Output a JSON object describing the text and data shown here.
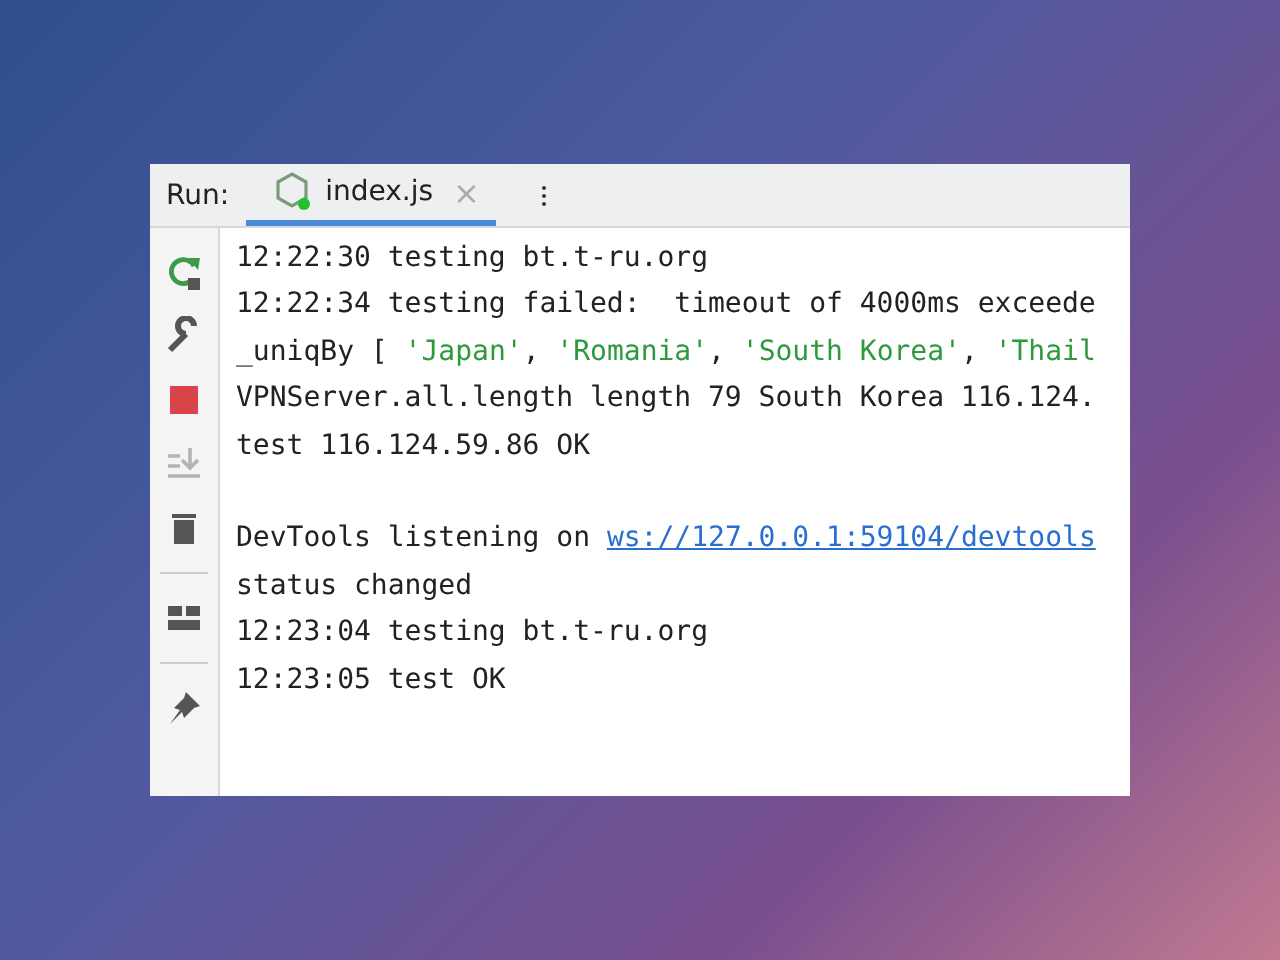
{
  "panel": {
    "label": "Run:",
    "tabs": [
      {
        "label": "index.js",
        "close": "×",
        "selected": true
      }
    ]
  },
  "toolbar": [
    {
      "kind": "rerun",
      "disabled": false
    },
    {
      "kind": "wrench",
      "disabled": false
    },
    {
      "kind": "stop",
      "disabled": false
    },
    {
      "kind": "scroll-end",
      "disabled": true
    },
    {
      "kind": "trash",
      "disabled": false
    },
    {
      "kind": "divider"
    },
    {
      "kind": "layout",
      "disabled": false
    },
    {
      "kind": "divider"
    },
    {
      "kind": "pin",
      "disabled": false
    }
  ],
  "console": [
    {
      "kind": "text",
      "segments": [
        {
          "kind": "plain",
          "text": "12:22:30 testing bt.t-ru.org"
        }
      ]
    },
    {
      "kind": "text",
      "segments": [
        {
          "kind": "plain",
          "text": "12:22:34 testing failed:  timeout of 4000ms exceede"
        }
      ]
    },
    {
      "kind": "text",
      "segments": [
        {
          "kind": "plain",
          "text": "_uniqBy [ "
        },
        {
          "kind": "string",
          "text": "'Japan'"
        },
        {
          "kind": "plain",
          "text": ", "
        },
        {
          "kind": "string",
          "text": "'Romania'"
        },
        {
          "kind": "plain",
          "text": ", "
        },
        {
          "kind": "string",
          "text": "'South Korea'"
        },
        {
          "kind": "plain",
          "text": ", "
        },
        {
          "kind": "string",
          "text": "'Thail"
        }
      ]
    },
    {
      "kind": "text",
      "segments": [
        {
          "kind": "plain",
          "text": "VPNServer.all.length length 79 South Korea 116.124."
        }
      ]
    },
    {
      "kind": "text",
      "segments": [
        {
          "kind": "plain",
          "text": "test 116.124.59.86 OK"
        }
      ]
    },
    {
      "kind": "blank"
    },
    {
      "kind": "text",
      "segments": [
        {
          "kind": "plain",
          "text": "DevTools listening on "
        },
        {
          "kind": "link",
          "text": "ws://127.0.0.1:59104/devtools"
        }
      ]
    },
    {
      "kind": "text",
      "segments": [
        {
          "kind": "plain",
          "text": "status changed"
        }
      ]
    },
    {
      "kind": "text",
      "segments": [
        {
          "kind": "plain",
          "text": "12:23:04 testing bt.t-ru.org"
        }
      ]
    },
    {
      "kind": "text",
      "segments": [
        {
          "kind": "plain",
          "text": "12:23:05 test OK"
        }
      ]
    }
  ]
}
